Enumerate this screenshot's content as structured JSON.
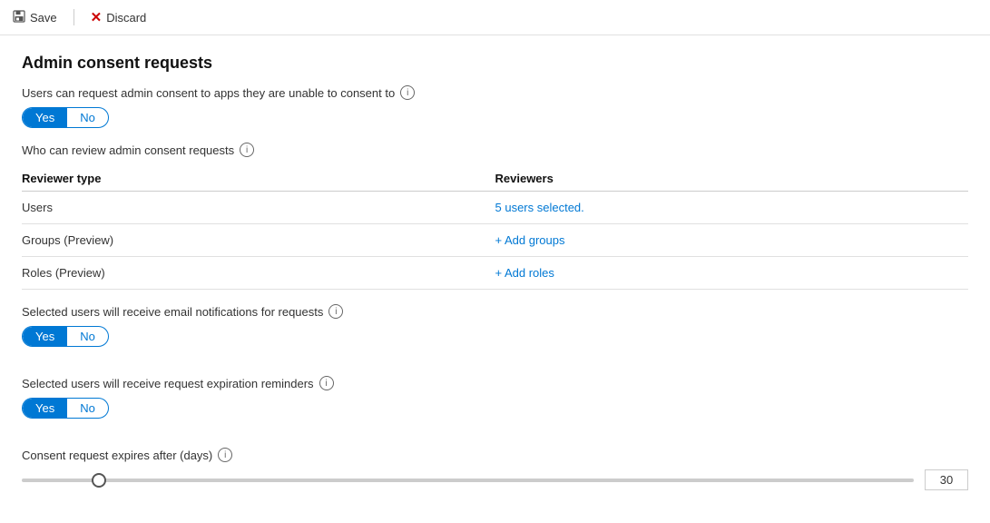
{
  "toolbar": {
    "save_label": "Save",
    "discard_label": "Discard"
  },
  "page": {
    "title": "Admin consent requests",
    "user_consent_label": "Users can request admin consent to apps they are unable to consent to",
    "who_review_label": "Who can review admin consent requests",
    "reviewer_type_col": "Reviewer type",
    "reviewers_col": "Reviewers",
    "rows": [
      {
        "type": "Users",
        "reviewers_text": "5 users selected.",
        "link": false
      },
      {
        "type": "Groups (Preview)",
        "reviewers_link": "+ Add groups",
        "link": true
      },
      {
        "type": "Roles (Preview)",
        "reviewers_link": "+ Add roles",
        "link": true
      }
    ],
    "email_notif_label": "Selected users will receive email notifications for requests",
    "expiration_label": "Selected users will receive request expiration reminders",
    "consent_days_label": "Consent request expires after (days)",
    "yes_label": "Yes",
    "no_label": "No",
    "toggle_user_consent": "yes",
    "toggle_email": "yes",
    "toggle_expiration": "yes",
    "slider_value": "30",
    "info_icon": "i"
  }
}
